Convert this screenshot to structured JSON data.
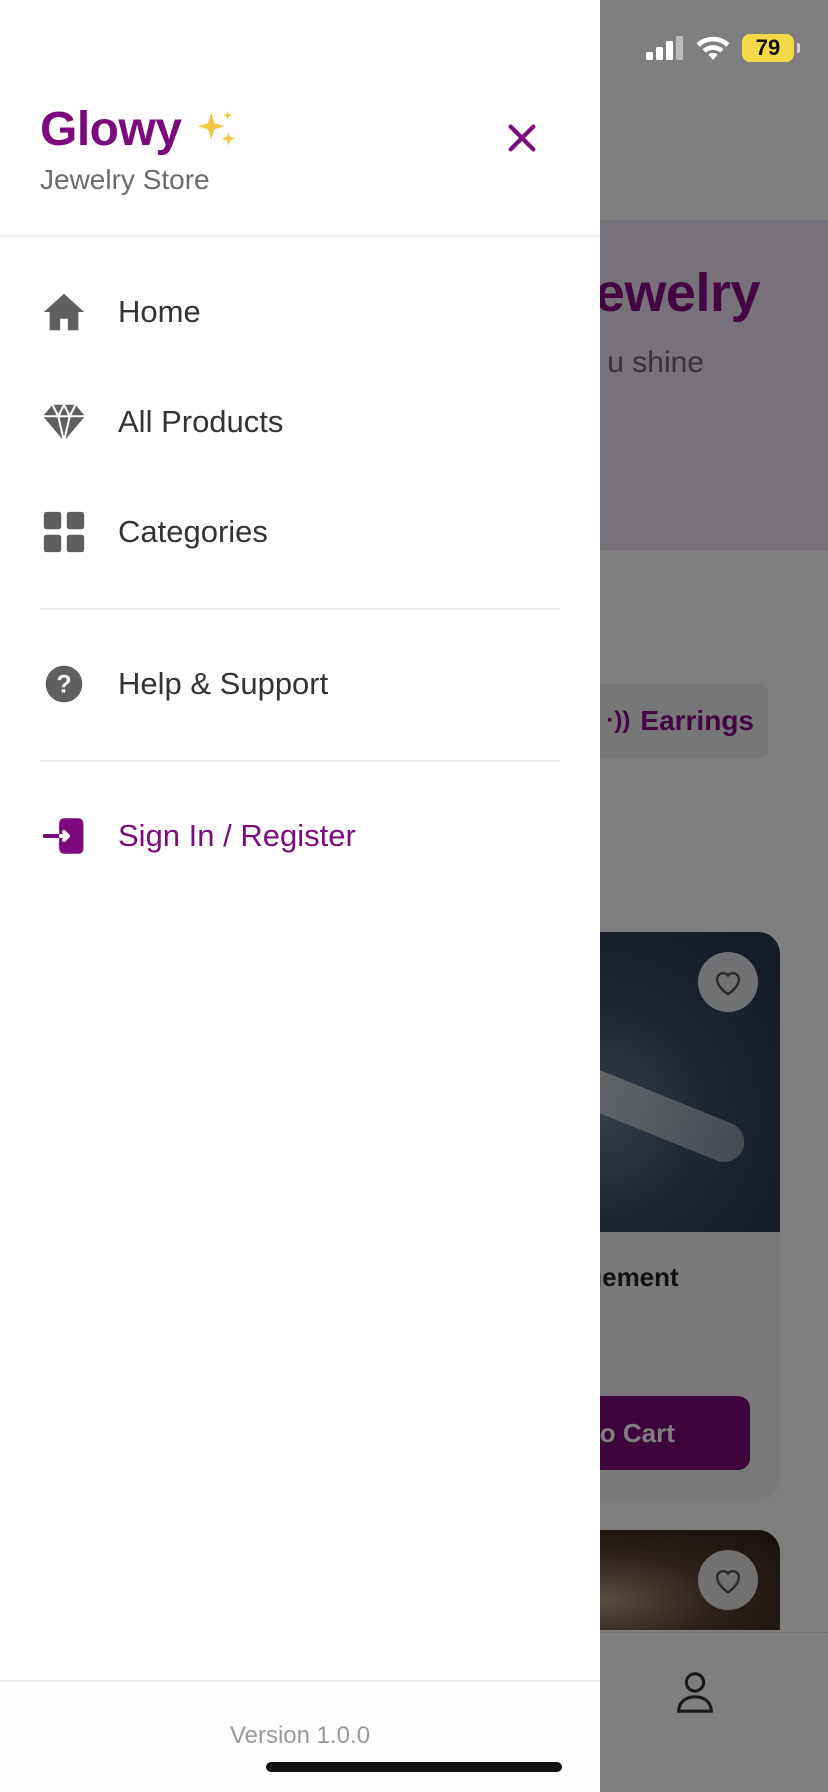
{
  "status_bar": {
    "battery": "79"
  },
  "background": {
    "hero_title": "ewelry",
    "hero_subtitle": "u shine",
    "chip_label": "Earrings",
    "product_title": "ngagement",
    "add_to_cart": "d to Cart"
  },
  "drawer": {
    "brand_name": "Glowy",
    "brand_emoji": "✨",
    "brand_subtitle": "Jewelry Store",
    "menu": [
      {
        "label": "Home",
        "icon": "home-icon"
      },
      {
        "label": "All Products",
        "icon": "diamond-icon"
      },
      {
        "label": "Categories",
        "icon": "grid-icon"
      },
      {
        "label": "Help & Support",
        "icon": "help-circle-icon"
      },
      {
        "label": "Sign In / Register",
        "icon": "sign-in-icon"
      }
    ],
    "version": "Version 1.0.0"
  },
  "colors": {
    "accent": "#7c0a7e",
    "icon_gray": "#5f5f5f",
    "text": "#333333"
  }
}
